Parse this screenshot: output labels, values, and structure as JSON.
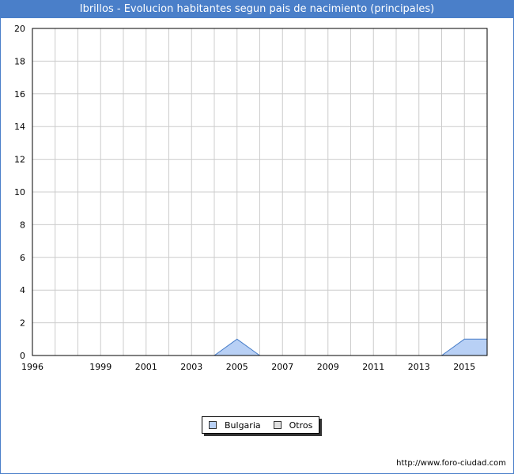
{
  "title": "Ibrillos - Evolucion habitantes segun pais de nacimiento (principales)",
  "footer": "http://www.foro-ciudad.com",
  "colors": {
    "accent": "#4a7fc9",
    "bulgaria_fill": "#b8d0f5",
    "bulgaria_line": "#4a7fc9",
    "otros_fill": "#e0e0e0",
    "grid": "#cccccc"
  },
  "chart_data": {
    "type": "area",
    "title": "Ibrillos - Evolucion habitantes segun pais de nacimiento (principales)",
    "xlabel": "",
    "ylabel": "",
    "x": [
      1996,
      1997,
      1998,
      1999,
      2000,
      2001,
      2002,
      2003,
      2004,
      2005,
      2006,
      2007,
      2008,
      2009,
      2010,
      2011,
      2012,
      2013,
      2014,
      2015,
      2016
    ],
    "xticks": [
      "1996",
      "1999",
      "2001",
      "2003",
      "2005",
      "2007",
      "2009",
      "2011",
      "2013",
      "2015"
    ],
    "yticks": [
      "0",
      "2",
      "4",
      "6",
      "8",
      "10",
      "12",
      "14",
      "16",
      "18",
      "20"
    ],
    "ylim": [
      0,
      20
    ],
    "grid": true,
    "legend_position": "bottom-center",
    "series": [
      {
        "name": "Bulgaria",
        "values": [
          0,
          0,
          0,
          0,
          0,
          0,
          0,
          0,
          0,
          1,
          0,
          0,
          0,
          0,
          0,
          0,
          0,
          0,
          0,
          1,
          1
        ]
      },
      {
        "name": "Otros",
        "values": [
          0,
          0,
          0,
          0,
          0,
          0,
          0,
          0,
          0,
          0,
          0,
          0,
          0,
          0,
          0,
          0,
          0,
          0,
          0,
          0,
          0
        ]
      }
    ]
  }
}
